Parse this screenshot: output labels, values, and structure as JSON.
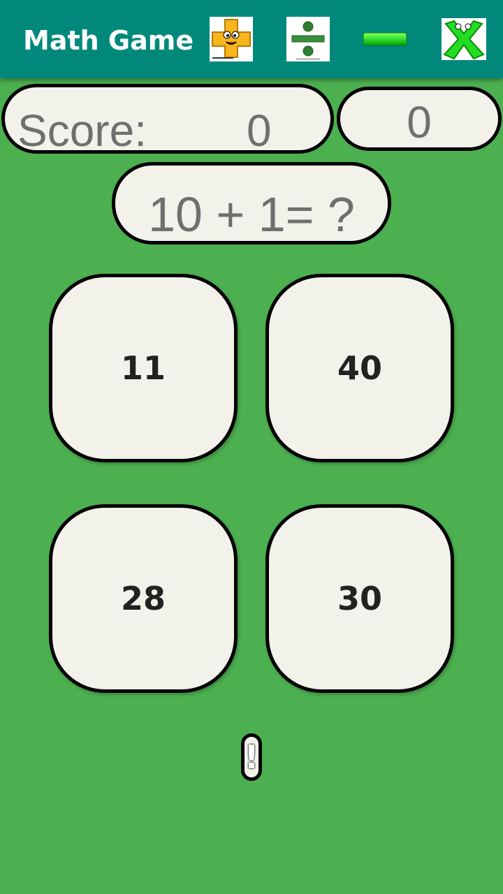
{
  "appbar": {
    "title": "Math Game",
    "operations": [
      {
        "icon": "plus-mascot-icon"
      },
      {
        "icon": "divide-icon"
      },
      {
        "icon": "minus-icon"
      },
      {
        "icon": "times-icon"
      }
    ],
    "colors": {
      "appbar": "#00897b",
      "background": "#4caf50",
      "panel": "#f2f1ea"
    }
  },
  "score": {
    "label": "Score:",
    "value": "0"
  },
  "timer": {
    "value": "0"
  },
  "question": {
    "text": "10 + 1= ?"
  },
  "answers": [
    "11",
    "40",
    "28",
    "30"
  ],
  "hint": {
    "label": "!",
    "icon": "exclamation-icon"
  }
}
